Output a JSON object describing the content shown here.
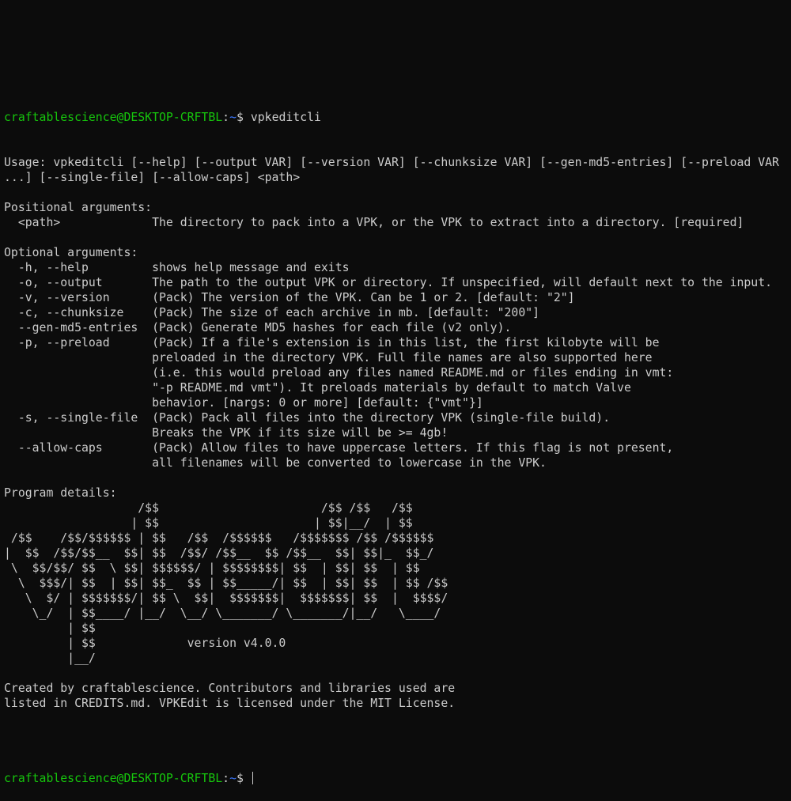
{
  "prompt": {
    "user_host": "craftablescience@DESKTOP-CRFTBL",
    "separator": ":",
    "path": "~",
    "symbol": "$ "
  },
  "command": "vpkeditcli",
  "output_lines": [
    "Usage: vpkeditcli [--help] [--output VAR] [--version VAR] [--chunksize VAR] [--gen-md5-entries] [--preload VAR",
    "...] [--single-file] [--allow-caps] <path>",
    "",
    "Positional arguments:",
    "  <path>             The directory to pack into a VPK, or the VPK to extract into a directory. [required]",
    "",
    "Optional arguments:",
    "  -h, --help         shows help message and exits",
    "  -o, --output       The path to the output VPK or directory. If unspecified, will default next to the input.",
    "  -v, --version      (Pack) The version of the VPK. Can be 1 or 2. [default: \"2\"]",
    "  -c, --chunksize    (Pack) The size of each archive in mb. [default: \"200\"]",
    "  --gen-md5-entries  (Pack) Generate MD5 hashes for each file (v2 only).",
    "  -p, --preload      (Pack) If a file's extension is in this list, the first kilobyte will be",
    "                     preloaded in the directory VPK. Full file names are also supported here",
    "                     (i.e. this would preload any files named README.md or files ending in vmt:",
    "                     \"-p README.md vmt\"). It preloads materials by default to match Valve",
    "                     behavior. [nargs: 0 or more] [default: {\"vmt\"}]",
    "  -s, --single-file  (Pack) Pack all files into the directory VPK (single-file build).",
    "                     Breaks the VPK if its size will be >= 4gb!",
    "  --allow-caps       (Pack) Allow files to have uppercase letters. If this flag is not present,",
    "                     all filenames will be converted to lowercase in the VPK.",
    "",
    "Program details:",
    "                   /$$                       /$$ /$$   /$$",
    "                  | $$                      | $$|__/  | $$",
    " /$$    /$$/$$$$$$ | $$   /$$  /$$$$$$   /$$$$$$$ /$$ /$$$$$$",
    "|  $$  /$$/$$__  $$| $$  /$$/ /$$__  $$ /$$__  $$| $$|_  $$_/",
    " \\  $$/$$/ $$  \\ $$| $$$$$$/ | $$$$$$$$| $$  | $$| $$  | $$",
    "  \\  $$$/| $$  | $$| $$_  $$ | $$_____/| $$  | $$| $$  | $$ /$$",
    "   \\  $/ | $$$$$$$/| $$ \\  $$|  $$$$$$$|  $$$$$$$| $$  |  $$$$/",
    "    \\_/  | $$____/ |__/  \\__/ \\_______/ \\_______/|__/   \\____/",
    "         | $$",
    "         | $$             version v4.0.0",
    "         |__/",
    "",
    "Created by craftablescience. Contributors and libraries used are",
    "listed in CREDITS.md. VPKEdit is licensed under the MIT License.",
    "",
    ""
  ]
}
